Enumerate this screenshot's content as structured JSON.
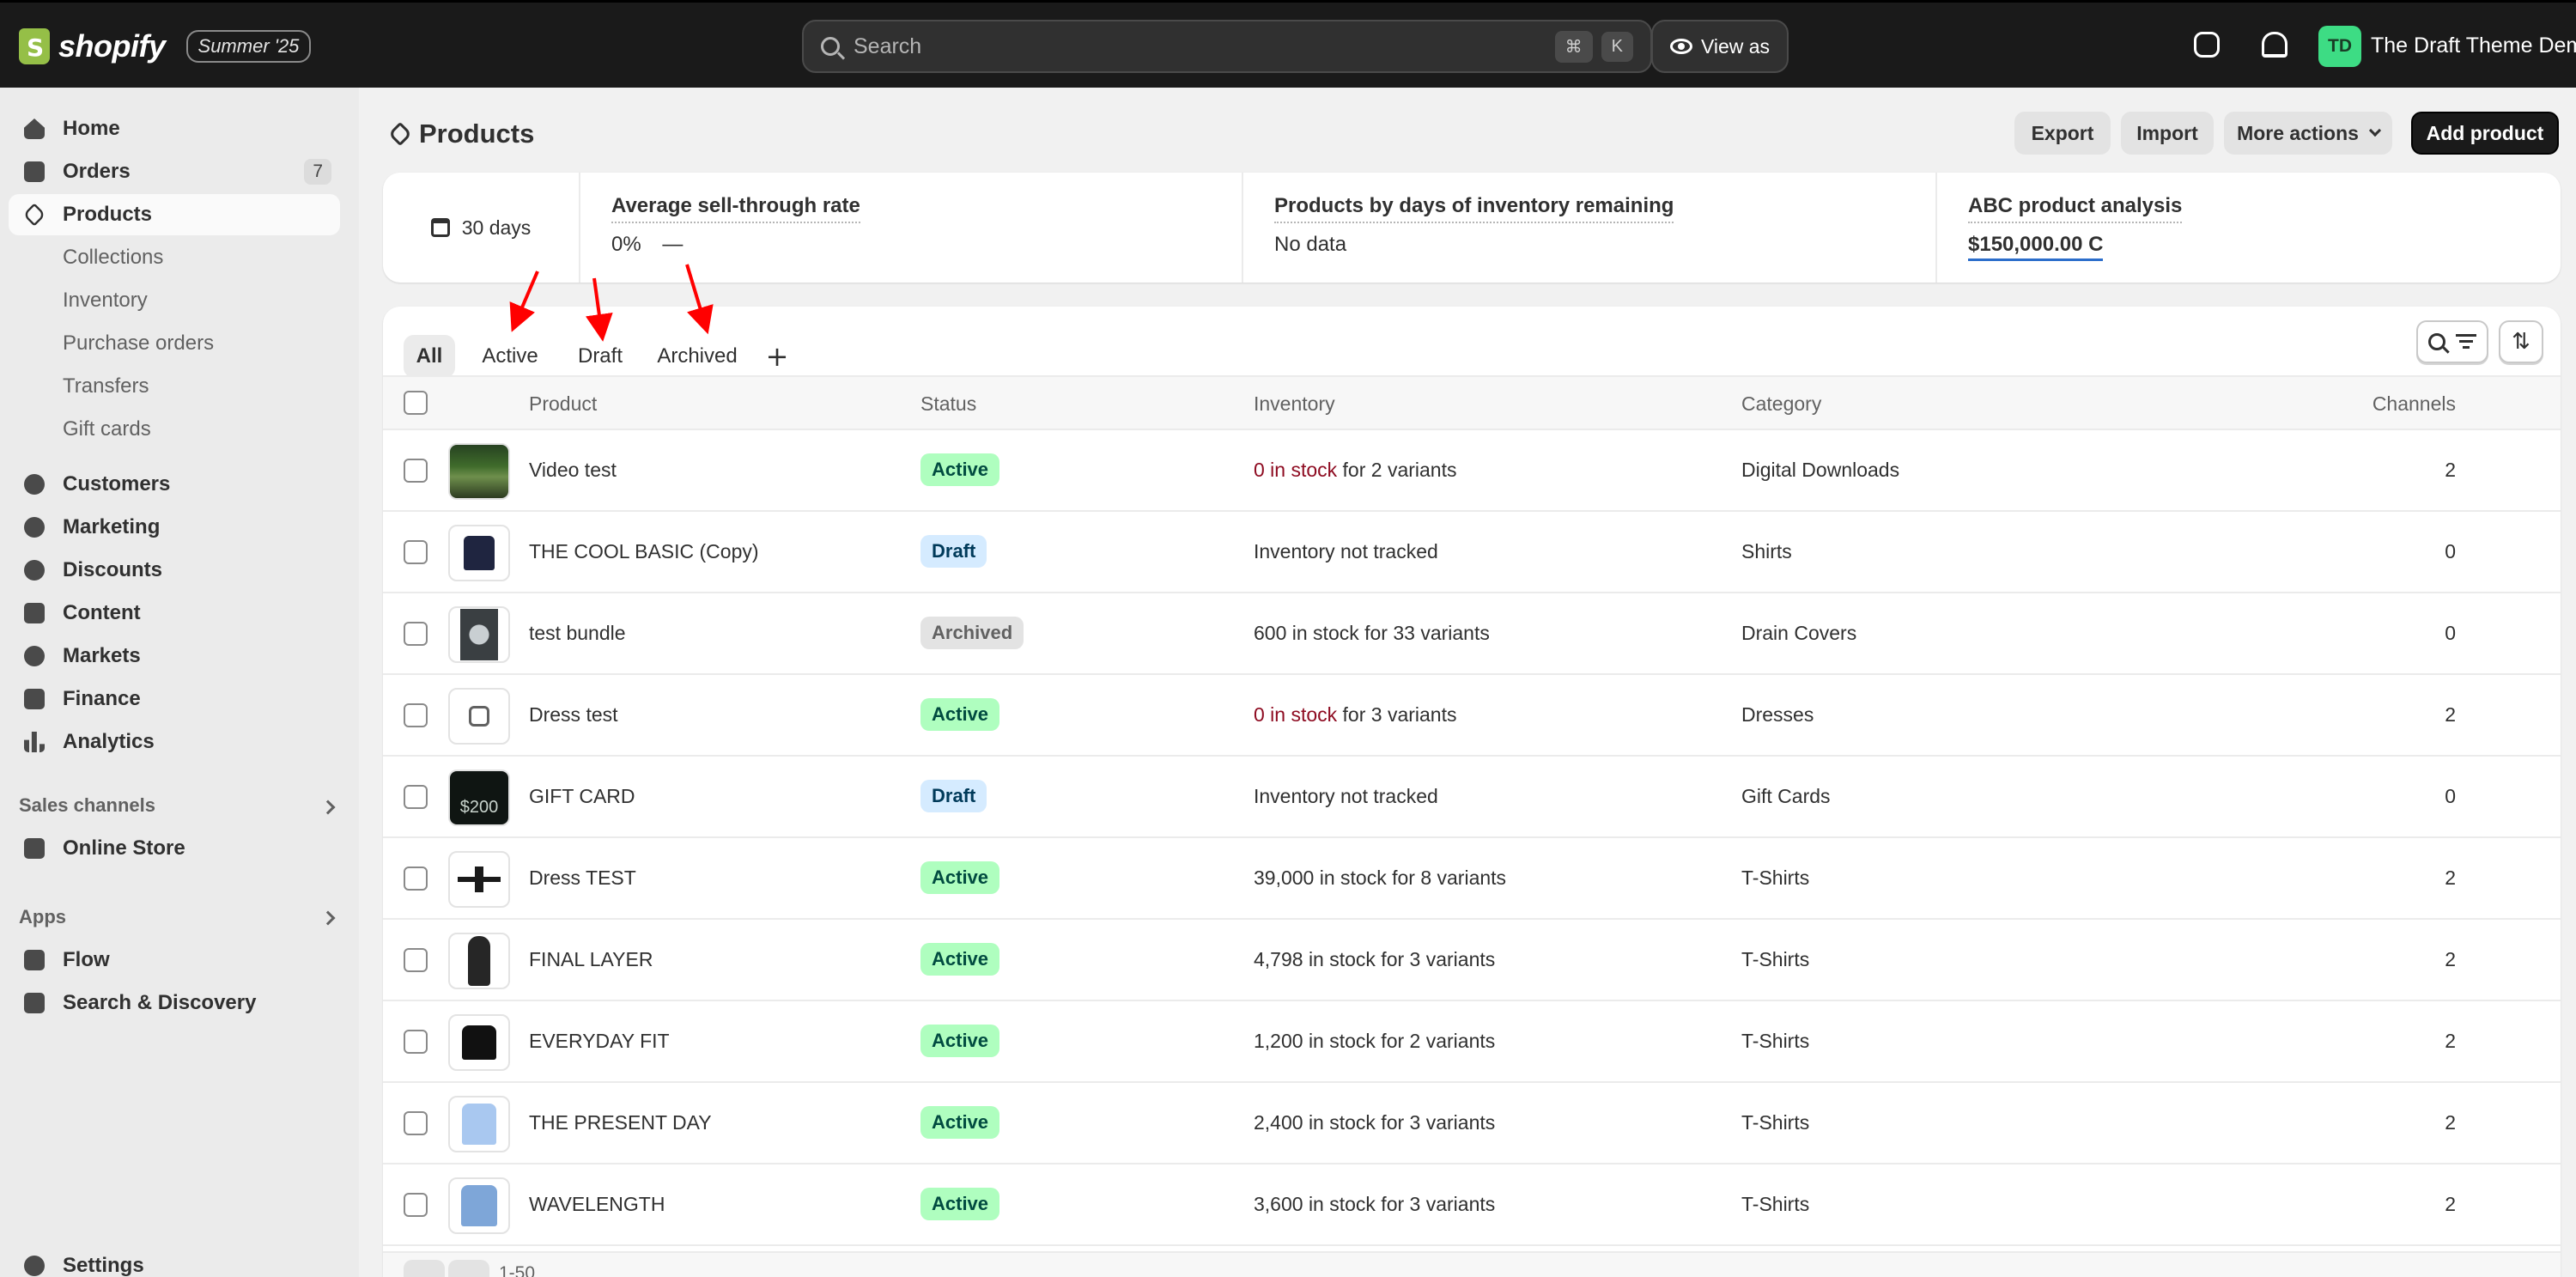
{
  "topbar": {
    "brand": "shopify",
    "edition_badge": "Summer '25",
    "search_placeholder": "Search",
    "shortcut_keys": [
      "⌘",
      "K"
    ],
    "view_as_label": "View as",
    "avatar_initials": "TD",
    "store_name": "The Draft Theme Demo"
  },
  "sidebar": {
    "items": [
      {
        "label": "Home",
        "icon": "home-icon"
      },
      {
        "label": "Orders",
        "icon": "inbox-icon",
        "badge": "7"
      },
      {
        "label": "Products",
        "icon": "tag-icon",
        "active": true
      },
      {
        "label": "Collections"
      },
      {
        "label": "Inventory"
      },
      {
        "label": "Purchase orders"
      },
      {
        "label": "Transfers"
      },
      {
        "label": "Gift cards"
      },
      {
        "label": "Customers",
        "icon": "person-icon"
      },
      {
        "label": "Marketing",
        "icon": "target-icon"
      },
      {
        "label": "Discounts",
        "icon": "discount-icon"
      },
      {
        "label": "Content",
        "icon": "content-icon"
      },
      {
        "label": "Markets",
        "icon": "globe-icon"
      },
      {
        "label": "Finance",
        "icon": "bank-icon"
      },
      {
        "label": "Analytics",
        "icon": "chart-bar-icon"
      }
    ],
    "sales_channels_label": "Sales channels",
    "online_store_label": "Online Store",
    "apps_label": "Apps",
    "apps": [
      {
        "label": "Flow",
        "icon": "flow-icon"
      },
      {
        "label": "Search & Discovery",
        "icon": "search-discovery-icon"
      }
    ],
    "settings_label": "Settings"
  },
  "page": {
    "title": "Products",
    "actions": {
      "export": "Export",
      "import": "Import",
      "more_actions": "More actions",
      "add_product": "Add product"
    }
  },
  "metrics": {
    "date_range": "30 days",
    "items": [
      {
        "label": "Average sell-through rate",
        "value": "0%",
        "trend": "—"
      },
      {
        "label": "Products by days of inventory remaining",
        "value": "No data"
      },
      {
        "label": "ABC product analysis",
        "value": "$150,000.00 C"
      }
    ]
  },
  "tabs": [
    "All",
    "Active",
    "Draft",
    "Archived"
  ],
  "table": {
    "headers": {
      "product": "Product",
      "status": "Status",
      "inventory": "Inventory",
      "category": "Category",
      "channels": "Channels"
    },
    "rows": [
      {
        "product": "Video test",
        "status": "Active",
        "inventory_alert": "0 in stock",
        "inventory_rest": " for 2 variants",
        "category": "Digital Downloads",
        "channels": "2"
      },
      {
        "product": "THE COOL BASIC (Copy)",
        "status": "Draft",
        "inventory_alert": "",
        "inventory_rest": "Inventory not tracked",
        "category": "Shirts",
        "channels": "0"
      },
      {
        "product": "test bundle",
        "status": "Archived",
        "inventory_alert": "",
        "inventory_rest": "600 in stock for 33 variants",
        "category": "Drain Covers",
        "channels": "0"
      },
      {
        "product": "Dress test",
        "status": "Active",
        "inventory_alert": "0 in stock",
        "inventory_rest": " for 3 variants",
        "category": "Dresses",
        "channels": "2"
      },
      {
        "product": "GIFT CARD",
        "status": "Draft",
        "inventory_alert": "",
        "inventory_rest": "Inventory not tracked",
        "category": "Gift Cards",
        "channels": "0"
      },
      {
        "product": "Dress TEST",
        "status": "Active",
        "inventory_alert": "",
        "inventory_rest": "39,000 in stock for 8 variants",
        "category": "T-Shirts",
        "channels": "2"
      },
      {
        "product": "FINAL LAYER",
        "status": "Active",
        "inventory_alert": "",
        "inventory_rest": "4,798 in stock for 3 variants",
        "category": "T-Shirts",
        "channels": "2"
      },
      {
        "product": "EVERYDAY FIT",
        "status": "Active",
        "inventory_alert": "",
        "inventory_rest": "1,200 in stock for 2 variants",
        "category": "T-Shirts",
        "channels": "2"
      },
      {
        "product": "THE PRESENT DAY",
        "status": "Active",
        "inventory_alert": "",
        "inventory_rest": "2,400 in stock for 3 variants",
        "category": "T-Shirts",
        "channels": "2"
      },
      {
        "product": "WAVELENGTH",
        "status": "Active",
        "inventory_alert": "",
        "inventory_rest": "3,600 in stock for 3 variants",
        "category": "T-Shirts",
        "channels": "2"
      }
    ],
    "pagination_label": "1-50",
    "gift_card_amount": "$200"
  },
  "colors": {
    "topbar_bg": "#1a1a1a",
    "active_badge": "#affebf",
    "draft_badge": "#d5ebff",
    "archived_badge": "#e3e3e3",
    "stock_alert": "#8e0b21",
    "annotation_arrow": "#ff0000"
  }
}
